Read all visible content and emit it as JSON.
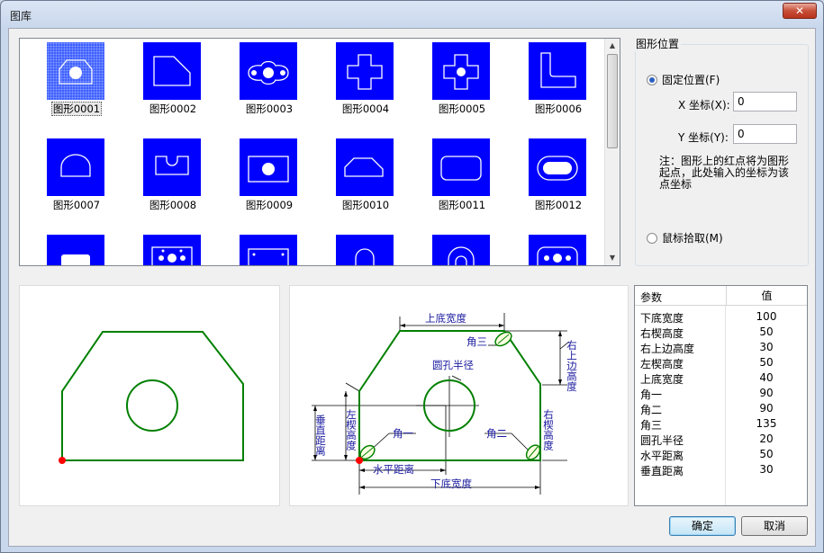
{
  "window": {
    "title": "图库",
    "close_label": "✕"
  },
  "gallery": {
    "items": [
      {
        "label": "图形0001",
        "selected": true
      },
      {
        "label": "图形0002"
      },
      {
        "label": "图形0003"
      },
      {
        "label": "图形0004"
      },
      {
        "label": "图形0005"
      },
      {
        "label": "图形0006"
      },
      {
        "label": "图形0007"
      },
      {
        "label": "图形0008"
      },
      {
        "label": "图形0009"
      },
      {
        "label": "图形0010"
      },
      {
        "label": "图形0011"
      },
      {
        "label": "图形0012"
      }
    ]
  },
  "position": {
    "group_title": "图形位置",
    "fixed_label": "固定位置(F)",
    "x_label": "X 坐标(X):",
    "x_value": "0",
    "y_label": "Y 坐标(Y):",
    "y_value": "0",
    "note": "注：图形上的红点将为图形起点，此处输入的坐标为该点坐标",
    "mouse_label": "鼠标拾取(M)"
  },
  "diagram": {
    "top_width": "上底宽度",
    "angle3": "角三",
    "right_top_height": "右上边高度",
    "hole_radius": "圆孔半径",
    "left_wedge_height": "左楔高度",
    "vertical_distance": "垂直距离",
    "angle1": "角一",
    "angle2": "角二",
    "right_wedge_height": "右楔高度",
    "horizontal_distance": "水平距离",
    "bottom_width": "下底宽度"
  },
  "params": {
    "header_param": "参数",
    "header_value": "值",
    "rows": [
      {
        "name": "下底宽度",
        "value": "100"
      },
      {
        "name": "右楔高度",
        "value": "50"
      },
      {
        "name": "右上边高度",
        "value": "30"
      },
      {
        "name": "左楔高度",
        "value": "50"
      },
      {
        "name": "上底宽度",
        "value": "40"
      },
      {
        "name": "角一",
        "value": "90"
      },
      {
        "name": "角二",
        "value": "90"
      },
      {
        "name": "角三",
        "value": "135"
      },
      {
        "name": "圆孔半径",
        "value": "20"
      },
      {
        "name": "水平距离",
        "value": "50"
      },
      {
        "name": "垂直距离",
        "value": "30"
      }
    ]
  },
  "buttons": {
    "ok": "确定",
    "cancel": "取消"
  },
  "colors": {
    "thumb_bg": "#0000ff",
    "shape_line": "#008000",
    "dim_blue": "#1a1aa0",
    "origin_red": "#ff0000"
  }
}
